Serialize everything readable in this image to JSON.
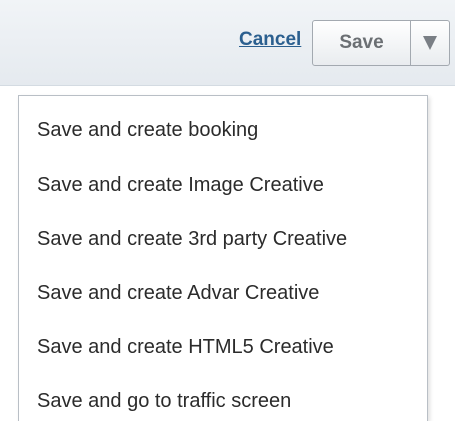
{
  "toolbar": {
    "cancel_label": "Cancel",
    "save_label": "Save",
    "dropdown_icon": "caret-down-icon"
  },
  "menu": {
    "items": [
      {
        "label": "Save and create booking"
      },
      {
        "label": "Save and create Image Creative"
      },
      {
        "label": "Save and create 3rd party Creative"
      },
      {
        "label": "Save and create Advar Creative"
      },
      {
        "label": "Save and create HTML5 Creative"
      },
      {
        "label": "Save and go to traffic screen"
      }
    ]
  },
  "colors": {
    "link": "#2b5f8f",
    "toolbar_bg": "#e5eaef",
    "menu_text": "#2b2b2b"
  }
}
